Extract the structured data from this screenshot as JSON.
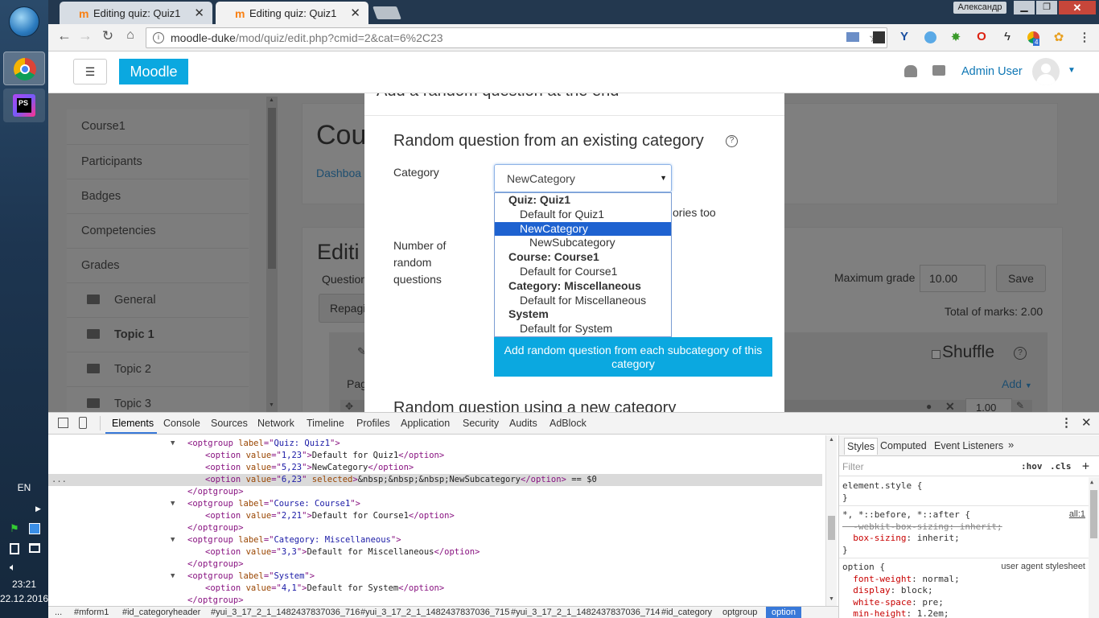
{
  "taskbar": {
    "lang": "EN",
    "time": "23:21",
    "date": "22.12.2016",
    "ps_label": "PS"
  },
  "browser": {
    "tabs": [
      {
        "label": "Editing quiz: Quiz1"
      },
      {
        "label": "Editing quiz: Quiz1"
      }
    ],
    "window_user": "Александр",
    "url_host": "moodle-duke",
    "url_path": "/mod/quiz/edit.php?cmid=2&cat=6%2C23",
    "ext_badge": "4"
  },
  "moodle": {
    "brand": "Moodle",
    "menu_glyph": "☰",
    "user_name": "Admin User",
    "nav": {
      "items": [
        "Course1",
        "Participants",
        "Badges",
        "Competencies",
        "Grades"
      ],
      "folders": [
        "General",
        "Topic 1",
        "Topic 2",
        "Topic 3"
      ]
    },
    "page": {
      "title_frag": "Cou",
      "dashboard_frag": "Dashboa",
      "editing_frag": "Editi",
      "question_frag": "Question",
      "repaginate_frag": "Repagi",
      "max_grade_label": "Maximum grade",
      "max_grade_value": "10.00",
      "save": "Save",
      "total_marks": "Total of marks: 2.00",
      "shuffle": "Shuffle",
      "page_frag": "Pag",
      "add": "Add",
      "mark_value": "1.00"
    }
  },
  "modal": {
    "title_frag": "Add a random question at the end",
    "section1": "Random question from an existing category",
    "category_label": "Category",
    "category_selected": "NewCategory",
    "subcats_frag": "ories too",
    "number_label": "Number of random questions",
    "add_button": "Add random question from each subcategory of this category",
    "section2_frag": "Random question using a new category",
    "dropdown": [
      {
        "type": "group",
        "label": "Quiz: Quiz1"
      },
      {
        "type": "option",
        "label": "Default for Quiz1"
      },
      {
        "type": "option",
        "label": "NewCategory",
        "selected": true
      },
      {
        "type": "sub",
        "label": "NewSubcategory"
      },
      {
        "type": "group",
        "label": "Course: Course1"
      },
      {
        "type": "option",
        "label": "Default for Course1"
      },
      {
        "type": "group",
        "label": "Category: Miscellaneous"
      },
      {
        "type": "option",
        "label": "Default for Miscellaneous"
      },
      {
        "type": "group",
        "label": "System"
      },
      {
        "type": "option",
        "label": "Default for System"
      }
    ]
  },
  "devtools": {
    "tabs": [
      "Elements",
      "Console",
      "Sources",
      "Network",
      "Timeline",
      "Profiles",
      "Application",
      "Security",
      "Audits",
      "AdBlock"
    ],
    "dom_lines": [
      {
        "indent": 0,
        "arrow": "▼",
        "parts": [
          [
            "t",
            "<optgroup "
          ],
          [
            "an",
            "label"
          ],
          [
            "t",
            "=\""
          ],
          [
            "av",
            "Quiz: Quiz1"
          ],
          [
            "t",
            "\">"
          ]
        ]
      },
      {
        "indent": 1,
        "arrow": "",
        "parts": [
          [
            "t",
            "<option "
          ],
          [
            "an",
            "value"
          ],
          [
            "t",
            "=\""
          ],
          [
            "av",
            "1,23"
          ],
          [
            "t",
            "\">"
          ],
          [
            "tx",
            "Default for Quiz1"
          ],
          [
            "t",
            "</option>"
          ]
        ]
      },
      {
        "indent": 1,
        "arrow": "",
        "parts": [
          [
            "t",
            "<option "
          ],
          [
            "an",
            "value"
          ],
          [
            "t",
            "=\""
          ],
          [
            "av",
            "5,23"
          ],
          [
            "t",
            "\">"
          ],
          [
            "tx",
            "NewCategory"
          ],
          [
            "t",
            "</option>"
          ]
        ]
      },
      {
        "indent": 1,
        "arrow": "",
        "sel": true,
        "parts": [
          [
            "t",
            "<option "
          ],
          [
            "an",
            "value"
          ],
          [
            "t",
            "=\""
          ],
          [
            "av",
            "6,23"
          ],
          [
            "t",
            "\" "
          ],
          [
            "an",
            "selected"
          ],
          [
            "t",
            ">"
          ],
          [
            "tx",
            "&nbsp;&nbsp;&nbsp;NewSubcategory"
          ],
          [
            "t",
            "</option>"
          ],
          [
            "tx",
            " == $0"
          ]
        ]
      },
      {
        "indent": 0,
        "arrow": "",
        "parts": [
          [
            "t",
            "</optgroup>"
          ]
        ]
      },
      {
        "indent": 0,
        "arrow": "▼",
        "parts": [
          [
            "t",
            "<optgroup "
          ],
          [
            "an",
            "label"
          ],
          [
            "t",
            "=\""
          ],
          [
            "av",
            "Course: Course1"
          ],
          [
            "t",
            "\">"
          ]
        ]
      },
      {
        "indent": 1,
        "arrow": "",
        "parts": [
          [
            "t",
            "<option "
          ],
          [
            "an",
            "value"
          ],
          [
            "t",
            "=\""
          ],
          [
            "av",
            "2,21"
          ],
          [
            "t",
            "\">"
          ],
          [
            "tx",
            "Default for Course1"
          ],
          [
            "t",
            "</option>"
          ]
        ]
      },
      {
        "indent": 0,
        "arrow": "",
        "parts": [
          [
            "t",
            "</optgroup>"
          ]
        ]
      },
      {
        "indent": 0,
        "arrow": "▼",
        "parts": [
          [
            "t",
            "<optgroup "
          ],
          [
            "an",
            "label"
          ],
          [
            "t",
            "=\""
          ],
          [
            "av",
            "Category: Miscellaneous"
          ],
          [
            "t",
            "\">"
          ]
        ]
      },
      {
        "indent": 1,
        "arrow": "",
        "parts": [
          [
            "t",
            "<option "
          ],
          [
            "an",
            "value"
          ],
          [
            "t",
            "=\""
          ],
          [
            "av",
            "3,3"
          ],
          [
            "t",
            "\">"
          ],
          [
            "tx",
            "Default for Miscellaneous"
          ],
          [
            "t",
            "</option>"
          ]
        ]
      },
      {
        "indent": 0,
        "arrow": "",
        "parts": [
          [
            "t",
            "</optgroup>"
          ]
        ]
      },
      {
        "indent": 0,
        "arrow": "▼",
        "parts": [
          [
            "t",
            "<optgroup "
          ],
          [
            "an",
            "label"
          ],
          [
            "t",
            "=\""
          ],
          [
            "av",
            "System"
          ],
          [
            "t",
            "\">"
          ]
        ]
      },
      {
        "indent": 1,
        "arrow": "",
        "parts": [
          [
            "t",
            "<option "
          ],
          [
            "an",
            "value"
          ],
          [
            "t",
            "=\""
          ],
          [
            "av",
            "4,1"
          ],
          [
            "t",
            "\">"
          ],
          [
            "tx",
            "Default for System"
          ],
          [
            "t",
            "</option>"
          ]
        ]
      },
      {
        "indent": 0,
        "arrow": "",
        "parts": [
          [
            "t",
            "</optgroup>"
          ]
        ]
      }
    ],
    "breadcrumbs": [
      "...",
      "#mform1",
      "#id_categoryheader",
      "#yui_3_17_2_1_1482437837036_716",
      "#yui_3_17_2_1_1482437837036_715",
      "#yui_3_17_2_1_1482437837036_714",
      "#id_category",
      "optgroup",
      "option"
    ],
    "styles_tabs": [
      "Styles",
      "Computed",
      "Event Listeners"
    ],
    "filter_placeholder": "Filter",
    "hov": ":hov",
    "cls": ".cls",
    "style_lines": [
      {
        "k": "sel",
        "text": "element.style {"
      },
      {
        "k": "plain",
        "text": "}"
      },
      {
        "k": "sel",
        "text": "*, *::before, *::after {",
        "src": "all:1"
      },
      {
        "k": "strike",
        "text": "  -webkit-box-sizing: inherit;"
      },
      {
        "k": "prop",
        "text": "  box-sizing: inherit;"
      },
      {
        "k": "plain",
        "text": "}"
      },
      {
        "k": "sel",
        "text": "option {",
        "src": "user agent stylesheet"
      },
      {
        "k": "prop",
        "text": "  font-weight: normal;"
      },
      {
        "k": "prop",
        "text": "  display: block;"
      },
      {
        "k": "prop",
        "text": "  white-space: pre;"
      },
      {
        "k": "prop",
        "text": "  min-height: 1.2em;"
      }
    ]
  },
  "colors": {
    "accent": "#0ba8e0",
    "selection": "#1e62d0",
    "link": "#0f77b5"
  }
}
